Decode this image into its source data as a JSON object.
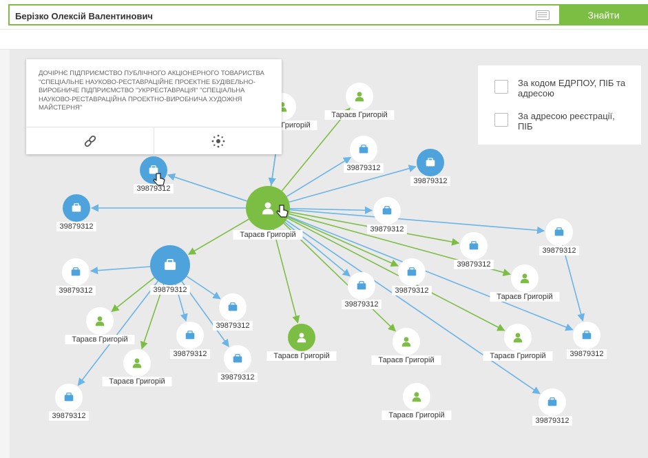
{
  "search": {
    "value": "Берізко Олексій Валентинович",
    "button_label": "Знайти"
  },
  "tooltip": {
    "text": "ДОЧІРНЄ ПІДПРИЄМСТВО ПУБЛІЧНОГО АКЦІОНЕРНОГО ТОВАРИСТВА \"СПЕЦІАЛЬНЕ НАУКОВО-РЕСТАВРАЦІЙНЕ ПРОЕКТНЕ БУДІВЕЛЬНО-ВИРОБНИЧЕ ПІДПРИЄМСТВО \"УКРРЕСТАВРАЦІЯ\" \"СПЕЦІАЛЬНА НАУКОВО-РЕСТАВРАЦІЙНА ПРОЕКТНО-ВИРОБНИЧА ХУДОЖНЯ МАЙСТЕРНЯ\"",
    "actions": [
      "link-icon",
      "network-icon"
    ]
  },
  "filters": [
    {
      "label": "За кодом ЕДРПОУ, ПІБ та адресою",
      "checked": false
    },
    {
      "label": "За адресою реєстрації, ПІБ",
      "checked": false
    }
  ],
  "colors": {
    "accent_green": "#7cbe43",
    "company_blue": "#4ea3dc",
    "edge_blue": "#6ab4e8",
    "edge_green": "#7cbe43",
    "canvas_bg": "#eaeaea"
  },
  "graph": {
    "nodes": [
      {
        "id": "p_main",
        "kind": "person",
        "label": "Тараєв Григорій",
        "filled": true,
        "big": true
      },
      {
        "id": "c_hub",
        "kind": "company",
        "label": "39879312",
        "filled": true,
        "big": true
      },
      {
        "id": "p_top_partial",
        "kind": "person",
        "label": "Тараєв Григорій",
        "filled": false
      },
      {
        "id": "p_top",
        "kind": "person",
        "label": "Тараєв Григорій",
        "filled": false
      },
      {
        "id": "c1",
        "kind": "company",
        "label": "39879312",
        "filled": false
      },
      {
        "id": "c2",
        "kind": "company",
        "label": "39879312",
        "filled": true
      },
      {
        "id": "c3",
        "kind": "company",
        "label": "39879312",
        "filled": true
      },
      {
        "id": "c4",
        "kind": "company",
        "label": "39879312",
        "filled": true
      },
      {
        "id": "c5",
        "kind": "company",
        "label": "39879312",
        "filled": false
      },
      {
        "id": "c6",
        "kind": "company",
        "label": "39879312",
        "filled": false
      },
      {
        "id": "c7",
        "kind": "company",
        "label": "39879312",
        "filled": false
      },
      {
        "id": "c8",
        "kind": "company",
        "label": "39879312",
        "filled": false
      },
      {
        "id": "c9",
        "kind": "company",
        "label": "39879312",
        "filled": false
      },
      {
        "id": "c10",
        "kind": "company",
        "label": "39879312",
        "filled": false
      },
      {
        "id": "c11",
        "kind": "company",
        "label": "39879312",
        "filled": false
      },
      {
        "id": "c12",
        "kind": "company",
        "label": "39879312",
        "filled": false
      },
      {
        "id": "c13",
        "kind": "company",
        "label": "39879312",
        "filled": false
      },
      {
        "id": "c14",
        "kind": "company",
        "label": "39879312",
        "filled": false
      },
      {
        "id": "c15",
        "kind": "company",
        "label": "39879312",
        "filled": false
      },
      {
        "id": "c16",
        "kind": "company",
        "label": "39879312",
        "filled": false
      },
      {
        "id": "p1",
        "kind": "person",
        "label": "Тараєв Григорій",
        "filled": false
      },
      {
        "id": "p2",
        "kind": "person",
        "label": "Тараєв Григорій",
        "filled": false
      },
      {
        "id": "p3",
        "kind": "person",
        "label": "Тараєв Григорій",
        "filled": true
      },
      {
        "id": "p4",
        "kind": "person",
        "label": "Тараєв Григорій",
        "filled": false
      },
      {
        "id": "p5",
        "kind": "person",
        "label": "Тараєв Григорій",
        "filled": false
      },
      {
        "id": "p6",
        "kind": "person",
        "label": "Тараєв Григорій",
        "filled": false
      },
      {
        "id": "p7",
        "kind": "person",
        "label": "Тараєв Григорій",
        "filled": false
      }
    ]
  }
}
